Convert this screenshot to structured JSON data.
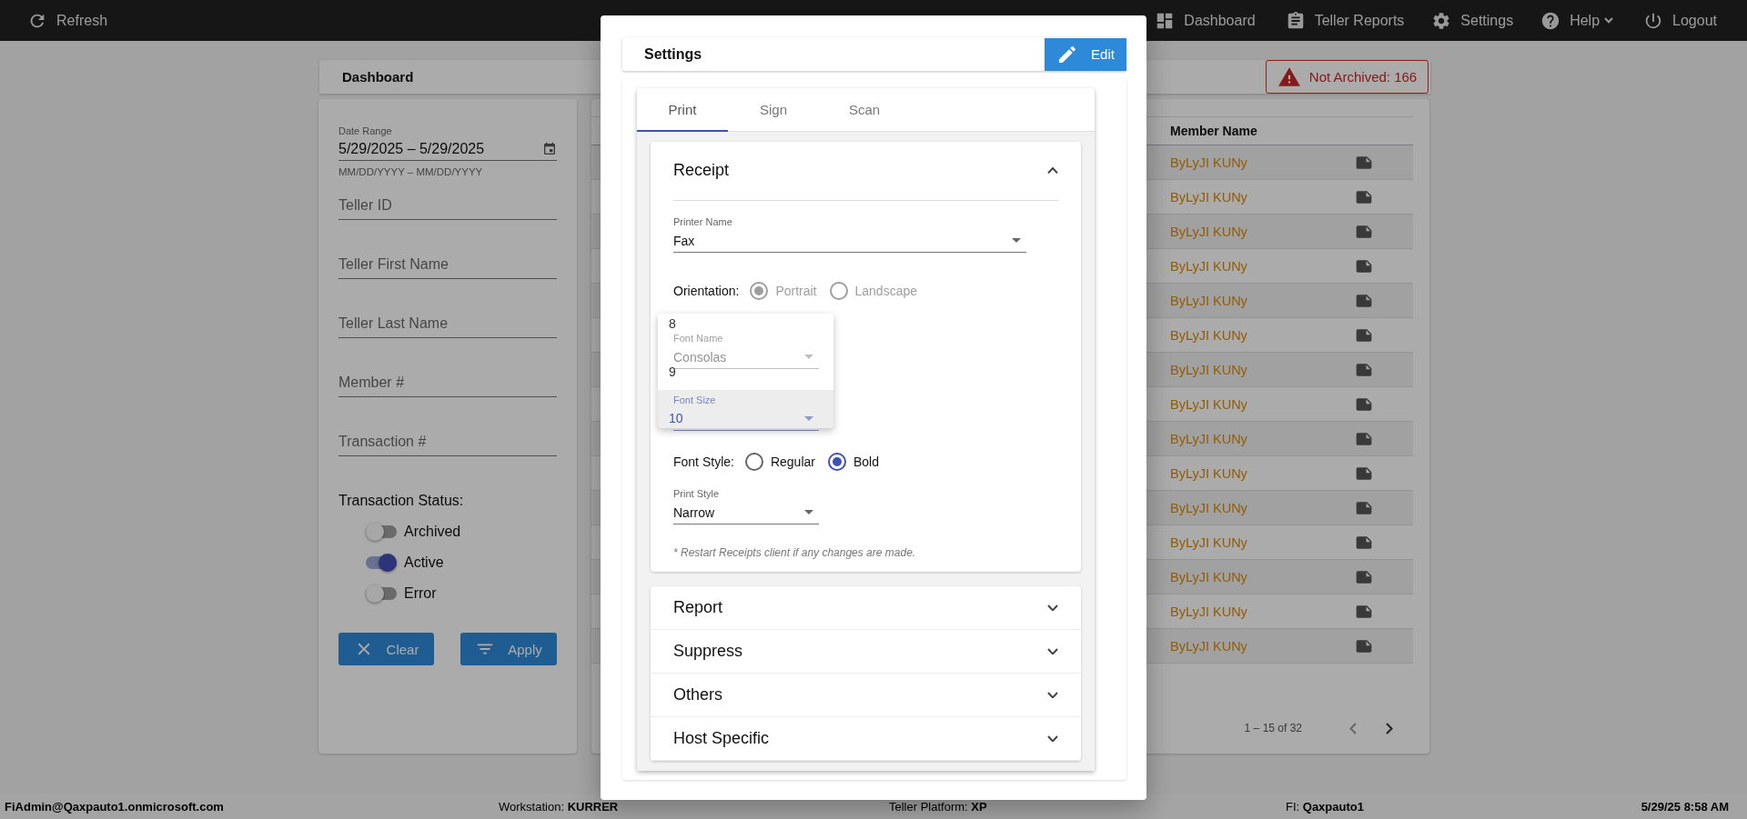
{
  "top_bar": {
    "left": [
      {
        "label": "Refresh",
        "kind": "refresh"
      }
    ],
    "nav": [
      {
        "label": "Dashboard",
        "kind": "dashboard"
      },
      {
        "label": "Teller Reports",
        "kind": "reports"
      },
      {
        "label": "Settings",
        "kind": "settings"
      },
      {
        "label": "Help",
        "kind": "help",
        "dropdown": true
      },
      {
        "label": "Logout",
        "kind": "logout"
      }
    ]
  },
  "dashboard": {
    "title": "Dashboard",
    "alert": "Not Archived: 166"
  },
  "filters": {
    "date_range": {
      "label": "Date Range",
      "value": "5/29/2025 – 5/29/2025",
      "hint": "MM/DD/YYYY – MM/DD/YYYY"
    },
    "fields": [
      {
        "placeholder": "Teller ID"
      },
      {
        "placeholder": "Teller First Name"
      },
      {
        "placeholder": "Teller Last Name"
      },
      {
        "placeholder": "Member #"
      },
      {
        "placeholder": "Transaction #"
      }
    ],
    "status_label": "Transaction Status:",
    "toggles": [
      {
        "label": "Archived",
        "on": false
      },
      {
        "label": "Active",
        "on": true
      },
      {
        "label": "Error",
        "on": false
      }
    ],
    "buttons": [
      {
        "label": "Clear",
        "kind": "clear"
      },
      {
        "label": "Apply",
        "kind": "apply"
      }
    ]
  },
  "table": {
    "columns": [
      "Member Name"
    ],
    "rows": [
      {
        "member_name": "ByLyJI KUNy"
      },
      {
        "member_name": "ByLyJI KUNy"
      },
      {
        "member_name": "ByLyJI KUNy"
      },
      {
        "member_name": "ByLyJI KUNy"
      },
      {
        "member_name": "ByLyJI KUNy"
      },
      {
        "member_name": "ByLyJI KUNy"
      },
      {
        "member_name": "ByLyJI KUNy"
      },
      {
        "member_name": "ByLyJI KUNy"
      },
      {
        "member_name": "ByLyJI KUNy"
      },
      {
        "member_name": "ByLyJI KUNy"
      },
      {
        "member_name": "ByLyJI KUNy"
      },
      {
        "member_name": "ByLyJI KUNy"
      },
      {
        "member_name": "ByLyJI KUNy"
      },
      {
        "member_name": "ByLyJI KUNy"
      },
      {
        "member_name": "ByLyJI KUNy"
      }
    ],
    "pagination": "1 – 15 of 32"
  },
  "status_bar": [
    {
      "value": "FiAdmin@Qaxpauto1.onmicrosoft.com"
    },
    {
      "label": "Workstation:",
      "value": "KURRER"
    },
    {
      "label": "Teller Platform:",
      "value": "XP"
    },
    {
      "label": "FI:",
      "value": "Qaxpauto1"
    },
    {
      "value": "5/29/25 8:58 AM"
    }
  ],
  "settings_dialog": {
    "title": "Settings",
    "edit_button": "Edit",
    "tabs": [
      {
        "label": "Print",
        "selected": true
      },
      {
        "label": "Sign",
        "selected": false
      },
      {
        "label": "Scan",
        "selected": false
      }
    ],
    "sections": [
      {
        "title": "Receipt",
        "expanded": true,
        "content": {
          "printer": {
            "label": "Printer Name",
            "value": "Fax"
          },
          "orientation": {
            "label": "Orientation:",
            "disabled": true,
            "options": [
              {
                "label": "Portrait",
                "selected": true
              },
              {
                "label": "Landscape",
                "selected": false
              }
            ]
          },
          "font_name": {
            "label": "Font Name",
            "value": "Consolas"
          },
          "font_size": {
            "label": "Font Size"
          },
          "font_size_menu": [
            {
              "label": "8",
              "selected": false
            },
            {
              "label": "9",
              "selected": false
            },
            {
              "label": "10",
              "selected": true
            }
          ],
          "font_style": {
            "label": "Font Style:",
            "disabled": false,
            "options": [
              {
                "label": "Regular",
                "selected": false
              },
              {
                "label": "Bold",
                "selected": true
              }
            ]
          },
          "print_style": {
            "label": "Print Style",
            "value": "Narrow"
          },
          "note": "* Restart Receipts client if any changes are made."
        }
      },
      {
        "title": "Report",
        "expanded": false
      },
      {
        "title": "Suppress",
        "expanded": false
      },
      {
        "title": "Others",
        "expanded": false
      },
      {
        "title": "Host Specific",
        "expanded": false
      }
    ]
  }
}
